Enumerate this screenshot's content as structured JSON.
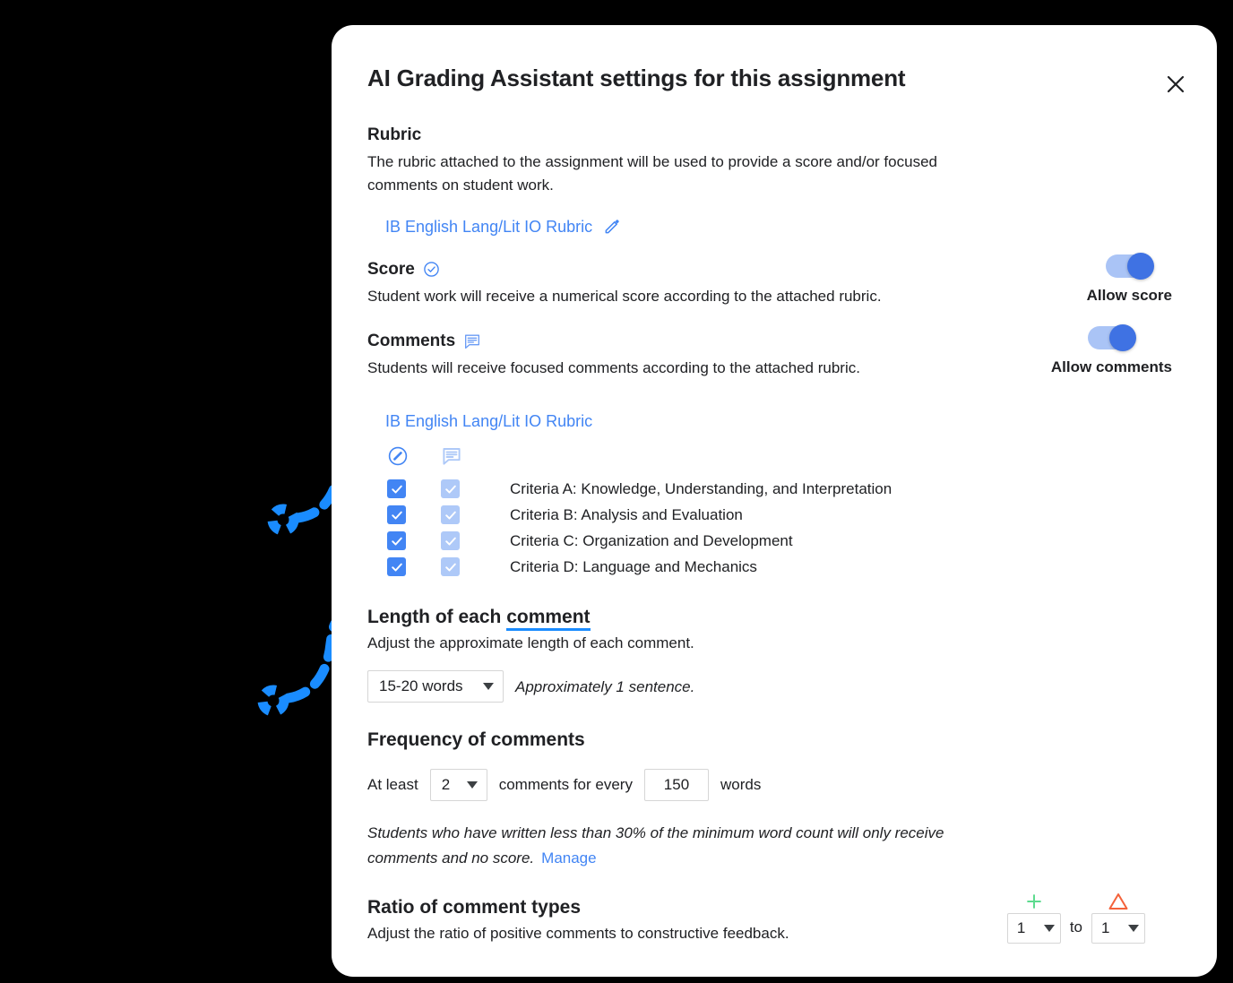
{
  "dialog": {
    "title": "AI Grading Assistant settings for this assignment",
    "close_icon": "close-icon"
  },
  "rubric": {
    "heading": "Rubric",
    "description": "The rubric attached to the assignment will be used to provide a score and/or focused comments on student work.",
    "link_label": "IB English Lang/Lit IO Rubric",
    "edit_icon": "pencil-icon"
  },
  "score": {
    "heading": "Score",
    "icon": "check-circle-icon",
    "description": "Student work will receive a numerical score according to the attached rubric.",
    "toggle_label": "Allow score",
    "toggle_on": true
  },
  "comments": {
    "heading": "Comments",
    "icon": "comment-icon",
    "description": "Students will receive focused comments according to the attached rubric.",
    "toggle_label": "Allow comments",
    "toggle_on": true
  },
  "criteria": {
    "rubric_link_label": "IB English Lang/Lit IO Rubric",
    "column_icons": [
      "score-circle-icon",
      "comment-bubble-icon"
    ],
    "items": [
      {
        "label": "Criteria A: Knowledge, Understanding, and Interpretation",
        "score_checked": true,
        "comment_checked": true
      },
      {
        "label": "Criteria B: Analysis and Evaluation",
        "score_checked": true,
        "comment_checked": true
      },
      {
        "label": "Criteria C: Organization and Development",
        "score_checked": true,
        "comment_checked": true
      },
      {
        "label": "Criteria D: Language and Mechanics",
        "score_checked": true,
        "comment_checked": true
      }
    ]
  },
  "length": {
    "heading_prefix": "Length of each ",
    "heading_accent": "comment",
    "description": "Adjust the approximate length of each comment.",
    "select_value": "15-20 words",
    "hint": "Approximately 1 sentence."
  },
  "frequency": {
    "heading": "Frequency of comments",
    "prefix": "At least",
    "count_value": "2",
    "middle": "comments for every",
    "words_value": "150",
    "suffix": "words",
    "note": "Students who have written less than 30% of the minimum word count will only receive comments and no score.",
    "note_link": "Manage"
  },
  "ratio": {
    "heading": "Ratio of comment types",
    "description": "Adjust the ratio of positive comments to constructive feedback.",
    "positive_icon": "plus-icon",
    "constructive_icon": "triangle-warning-icon",
    "left_value": "1",
    "to_label": "to",
    "right_value": "1"
  },
  "annotations": {
    "arrow_color": "#1a8cff",
    "arrows": [
      "annotation-arrow-criteria",
      "annotation-arrow-length"
    ]
  },
  "colors": {
    "accent_blue": "#4285f4",
    "annotation_blue": "#1a8cff",
    "checkbox_strong": "#4285f4",
    "checkbox_light": "#aec9f8",
    "toggle_track": "#aac4f6",
    "toggle_knob": "#3f72e3",
    "positive_green": "#5ddb8f",
    "constructive_orange": "#f4623a",
    "backdrop": "#000000",
    "surface": "#ffffff"
  }
}
